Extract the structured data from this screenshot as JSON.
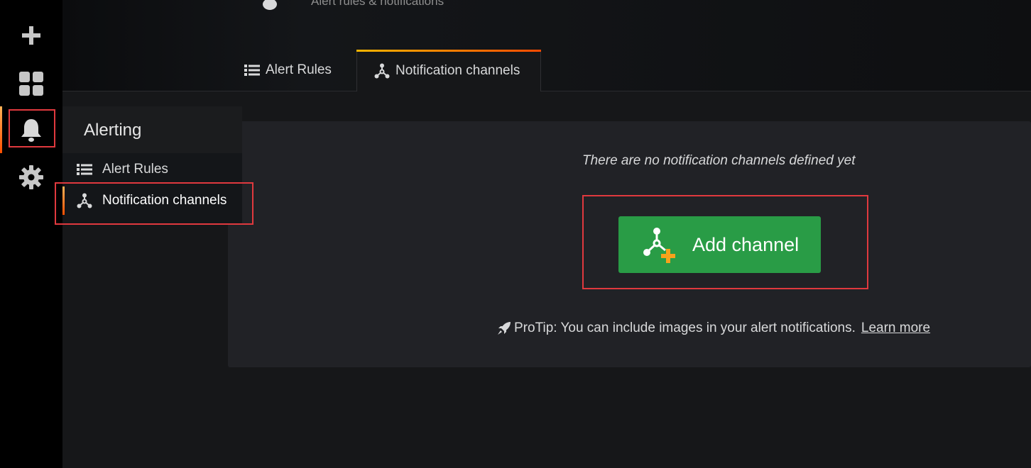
{
  "header": {
    "subtitle": "Alert rules & notifications",
    "tabs": [
      {
        "label": "Alert Rules",
        "icon": "list-icon",
        "active": false
      },
      {
        "label": "Notification channels",
        "icon": "channels-icon",
        "active": true
      }
    ]
  },
  "sidebar": {
    "icons": [
      "plus-icon",
      "dashboards-icon",
      "bell-icon",
      "gear-icon"
    ],
    "active": "bell-icon"
  },
  "menu": {
    "title": "Alerting",
    "items": [
      {
        "label": "Alert Rules",
        "icon": "list-icon",
        "active": false
      },
      {
        "label": "Notification channels",
        "icon": "channels-icon",
        "active": true
      }
    ]
  },
  "main": {
    "empty_message": "There are no notification channels defined yet",
    "add_button_label": "Add channel",
    "protip_text": "ProTip: You can include images in your alert notifications.",
    "learn_more_label": "Learn more"
  },
  "colors": {
    "accent_gradient_start": "#ffb357",
    "accent_gradient_end": "#ff4f00",
    "button_green": "#299c46",
    "highlight_red": "#e0393e"
  }
}
